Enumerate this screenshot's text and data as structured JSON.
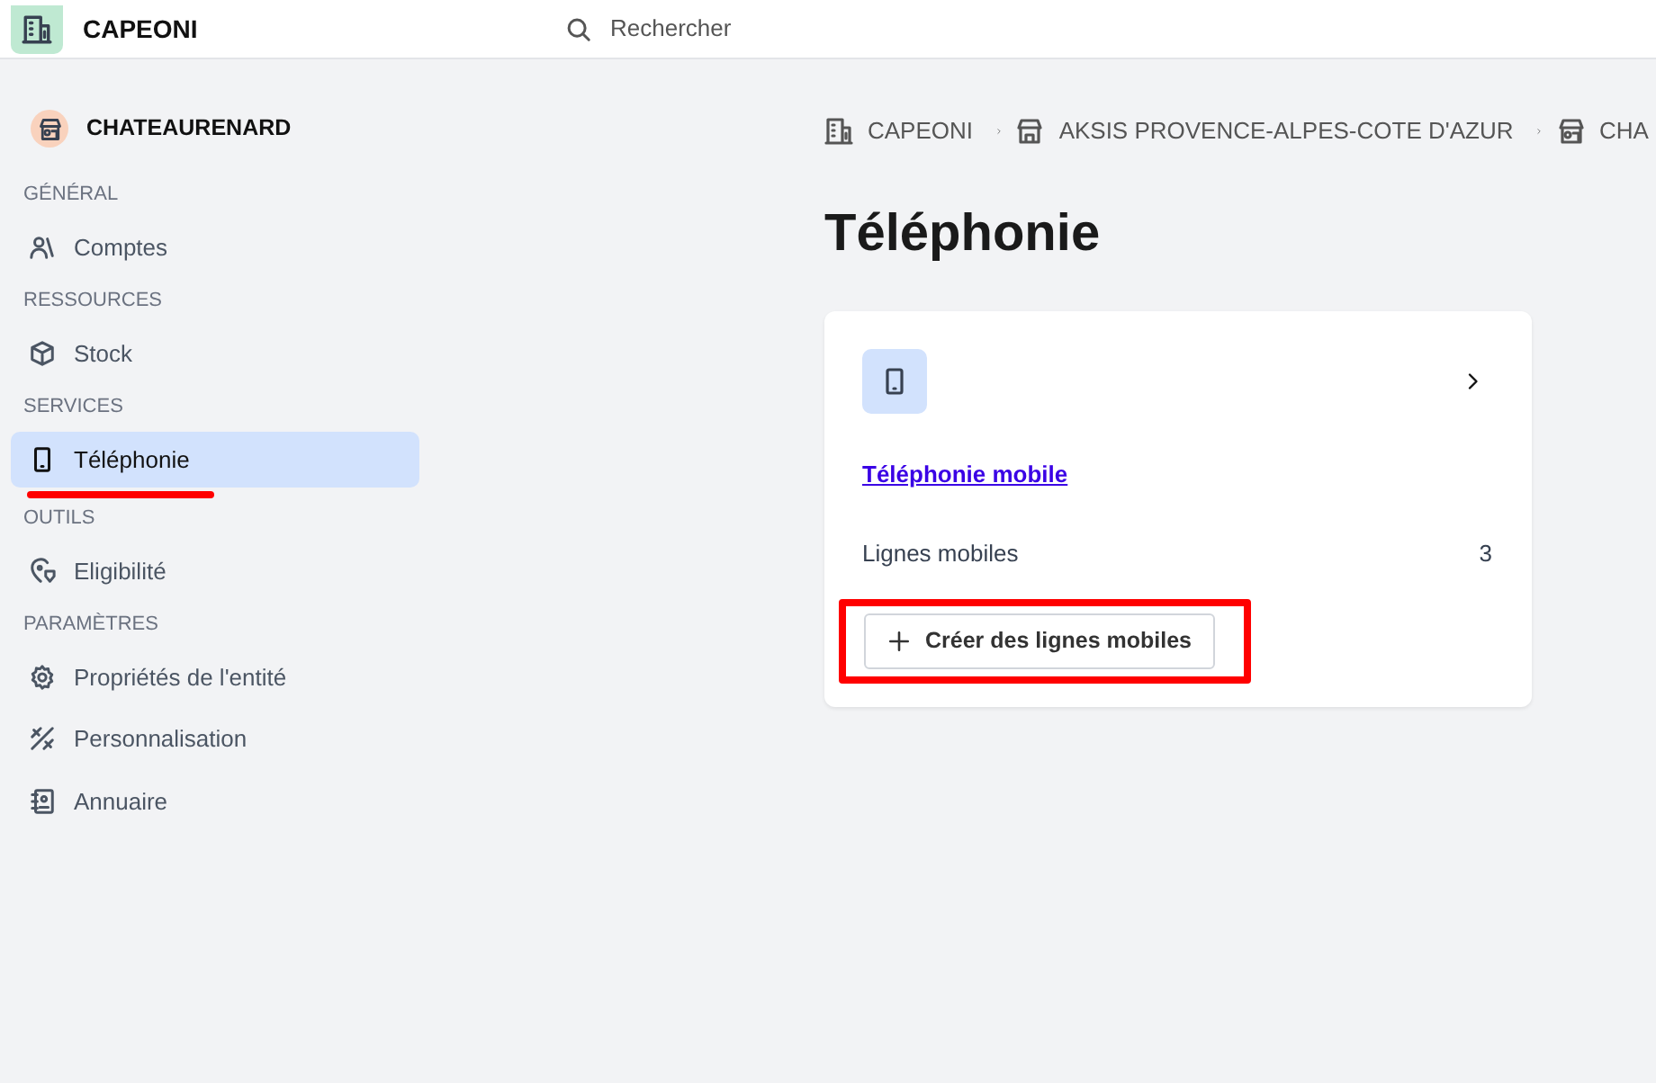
{
  "header": {
    "brand": "CAPEONI",
    "search": {
      "placeholder": "Rechercher"
    }
  },
  "sidebar": {
    "entity": "CHATEAURENARD",
    "sections": [
      {
        "title": "GÉNÉRAL",
        "items": [
          {
            "label": "Comptes",
            "kind": "users",
            "selected": false,
            "annotated": false
          }
        ]
      },
      {
        "title": "RESSOURCES",
        "items": [
          {
            "label": "Stock",
            "kind": "box",
            "selected": false,
            "annotated": false
          }
        ]
      },
      {
        "title": "SERVICES",
        "items": [
          {
            "label": "Téléphonie",
            "kind": "phone",
            "selected": true,
            "annotated": true
          }
        ]
      },
      {
        "title": "OUTILS",
        "items": [
          {
            "label": "Eligibilité",
            "kind": "pin",
            "selected": false,
            "annotated": false
          }
        ]
      },
      {
        "title": "PARAMÈTRES",
        "items": [
          {
            "label": "Propriétés de l'entité",
            "kind": "gear",
            "selected": false,
            "annotated": false
          },
          {
            "label": "Personnalisation",
            "kind": "tools",
            "selected": false,
            "annotated": false
          },
          {
            "label": "Annuaire",
            "kind": "book",
            "selected": false,
            "annotated": false
          }
        ]
      }
    ]
  },
  "breadcrumb": [
    {
      "label": "CAPEONI",
      "kind": "building"
    },
    {
      "label": "AKSIS PROVENCE-ALPES-COTE D'AZUR",
      "kind": "store"
    },
    {
      "label": "CHA",
      "kind": "shop"
    }
  ],
  "page_title": "Téléphonie",
  "card": {
    "title": "Téléphonie mobile",
    "stat_label": "Lignes mobiles",
    "stat_value": "3",
    "button": {
      "label": "Créer des lignes mobiles",
      "highlighted": true
    }
  }
}
